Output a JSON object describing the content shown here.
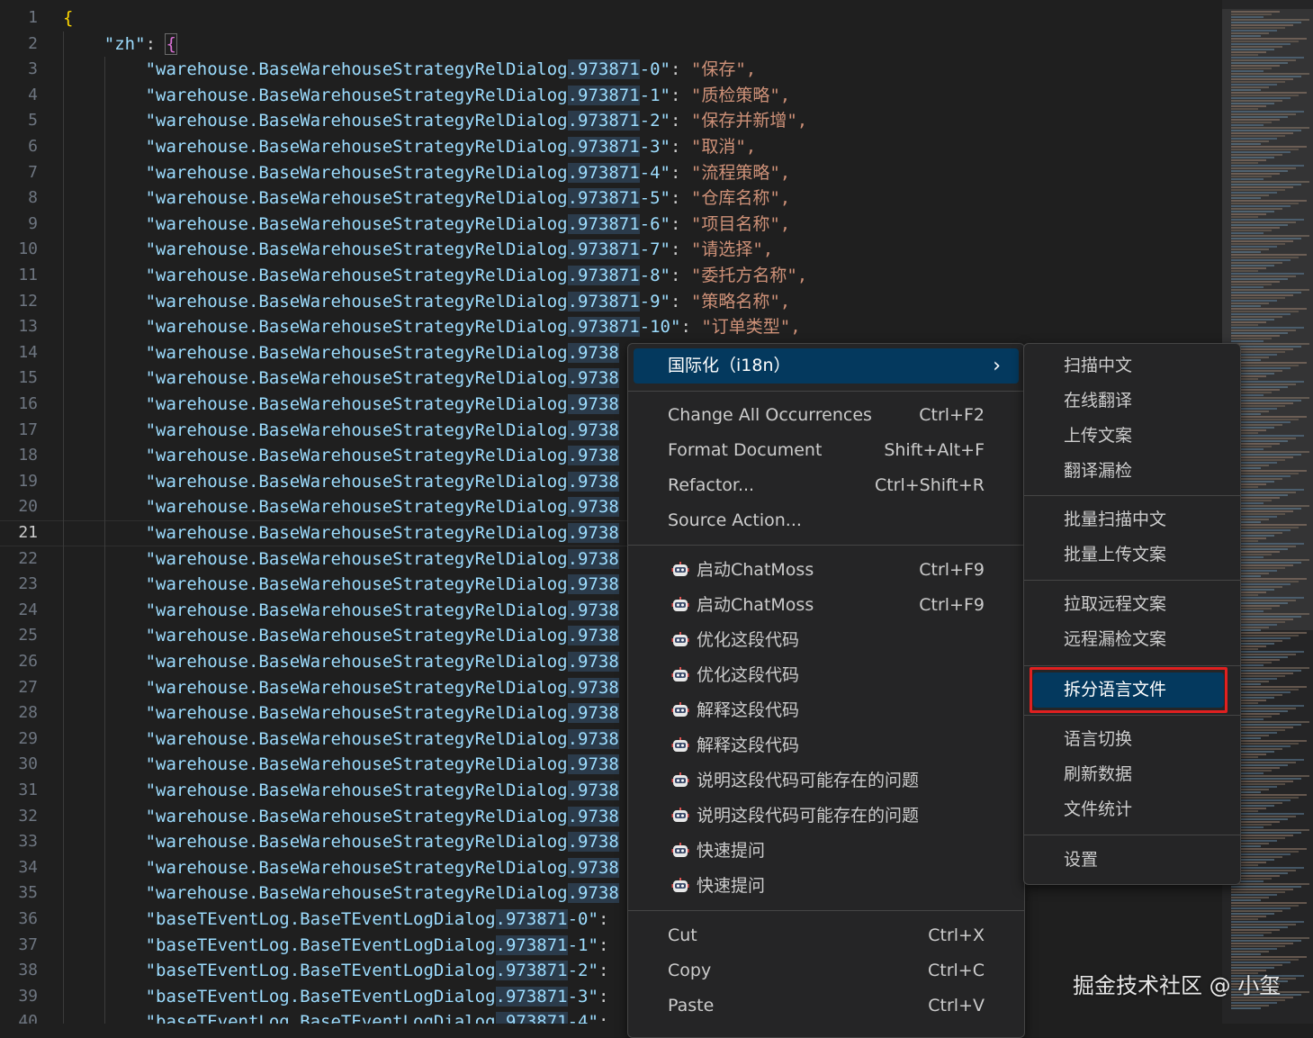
{
  "editor": {
    "current_line": 21,
    "lines": [
      {
        "n": "1",
        "open": "{"
      },
      {
        "n": "2",
        "key": "\"zh\"",
        "brace": "{"
      },
      {
        "n": "3",
        "key": "\"warehouse.BaseWarehouseStrategyRelDialog",
        "hl": ".973871",
        "rest": "-0\"",
        "value": "\"保存\","
      },
      {
        "n": "4",
        "key": "\"warehouse.BaseWarehouseStrategyRelDialog",
        "hl": ".973871",
        "rest": "-1\"",
        "value": "\"质检策略\","
      },
      {
        "n": "5",
        "key": "\"warehouse.BaseWarehouseStrategyRelDialog",
        "hl": ".973871",
        "rest": "-2\"",
        "value": "\"保存并新增\","
      },
      {
        "n": "6",
        "key": "\"warehouse.BaseWarehouseStrategyRelDialog",
        "hl": ".973871",
        "rest": "-3\"",
        "value": "\"取消\","
      },
      {
        "n": "7",
        "key": "\"warehouse.BaseWarehouseStrategyRelDialog",
        "hl": ".973871",
        "rest": "-4\"",
        "value": "\"流程策略\","
      },
      {
        "n": "8",
        "key": "\"warehouse.BaseWarehouseStrategyRelDialog",
        "hl": ".973871",
        "rest": "-5\"",
        "value": "\"仓库名称\","
      },
      {
        "n": "9",
        "key": "\"warehouse.BaseWarehouseStrategyRelDialog",
        "hl": ".973871",
        "rest": "-6\"",
        "value": "\"项目名称\","
      },
      {
        "n": "10",
        "key": "\"warehouse.BaseWarehouseStrategyRelDialog",
        "hl": ".973871",
        "rest": "-7\"",
        "value": "\"请选择\","
      },
      {
        "n": "11",
        "key": "\"warehouse.BaseWarehouseStrategyRelDialog",
        "hl": ".973871",
        "rest": "-8\"",
        "value": "\"委托方名称\","
      },
      {
        "n": "12",
        "key": "\"warehouse.BaseWarehouseStrategyRelDialog",
        "hl": ".973871",
        "rest": "-9\"",
        "value": "\"策略名称\","
      },
      {
        "n": "13",
        "key": "\"warehouse.BaseWarehouseStrategyRelDialog",
        "hl": ".973871",
        "rest": "-10\"",
        "value": "\"订单类型\","
      },
      {
        "n": "14",
        "key": "\"warehouse.BaseWarehouseStrategyRelDialog",
        "hl": ".9738"
      },
      {
        "n": "15",
        "key": "\"warehouse.BaseWarehouseStrategyRelDialog",
        "hl": ".9738"
      },
      {
        "n": "16",
        "key": "\"warehouse.BaseWarehouseStrategyRelDialog",
        "hl": ".9738"
      },
      {
        "n": "17",
        "key": "\"warehouse.BaseWarehouseStrategyRelDialog",
        "hl": ".9738"
      },
      {
        "n": "18",
        "key": "\"warehouse.BaseWarehouseStrategyRelDialog",
        "hl": ".9738"
      },
      {
        "n": "19",
        "key": "\"warehouse.BaseWarehouseStrategyRelDialog",
        "hl": ".9738"
      },
      {
        "n": "20",
        "key": "\"warehouse.BaseWarehouseStrategyRelDialog",
        "hl": ".9738"
      },
      {
        "n": "21",
        "key": "\"warehouse.BaseWarehouseStrategyRelDialog",
        "hl": ".9738"
      },
      {
        "n": "22",
        "key": "\"warehouse.BaseWarehouseStrategyRelDialog",
        "hl": ".9738"
      },
      {
        "n": "23",
        "key": "\"warehouse.BaseWarehouseStrategyRelDialog",
        "hl": ".9738"
      },
      {
        "n": "24",
        "key": "\"warehouse.BaseWarehouseStrategyRelDialog",
        "hl": ".9738"
      },
      {
        "n": "25",
        "key": "\"warehouse.BaseWarehouseStrategyRelDialog",
        "hl": ".9738"
      },
      {
        "n": "26",
        "key": "\"warehouse.BaseWarehouseStrategyRelDialog",
        "hl": ".9738"
      },
      {
        "n": "27",
        "key": "\"warehouse.BaseWarehouseStrategyRelDialog",
        "hl": ".9738"
      },
      {
        "n": "28",
        "key": "\"warehouse.BaseWarehouseStrategyRelDialog",
        "hl": ".9738"
      },
      {
        "n": "29",
        "key": "\"warehouse.BaseWarehouseStrategyRelDialog",
        "hl": ".9738"
      },
      {
        "n": "30",
        "key": "\"warehouse.BaseWarehouseStrategyRelDialog",
        "hl": ".9738"
      },
      {
        "n": "31",
        "key": "\"warehouse.BaseWarehouseStrategyRelDialog",
        "hl": ".9738"
      },
      {
        "n": "32",
        "key": "\"warehouse.BaseWarehouseStrategyRelDialog",
        "hl": ".9738"
      },
      {
        "n": "33",
        "key": "\"warehouse.BaseWarehouseStrategyRelDialog",
        "hl": ".9738"
      },
      {
        "n": "34",
        "key": "\"warehouse.BaseWarehouseStrategyRelDialog",
        "hl": ".9738"
      },
      {
        "n": "35",
        "key": "\"warehouse.BaseWarehouseStrategyRelDialog",
        "hl": ".9738"
      },
      {
        "n": "36",
        "key": "\"baseTEventLog.BaseTEventLogDialog",
        "hl": ".973871",
        "rest": "-0\""
      },
      {
        "n": "37",
        "key": "\"baseTEventLog.BaseTEventLogDialog",
        "hl": ".973871",
        "rest": "-1\""
      },
      {
        "n": "38",
        "key": "\"baseTEventLog.BaseTEventLogDialog",
        "hl": ".973871",
        "rest": "-2\""
      },
      {
        "n": "39",
        "key": "\"baseTEventLog.BaseTEventLogDialog",
        "hl": ".973871",
        "rest": "-3\""
      },
      {
        "n": "40",
        "key": "\"baseTEventLog.BaseTEventLogDialog",
        "hl": ".973871",
        "rest": "-4\""
      }
    ]
  },
  "context_menu": {
    "i18n": {
      "label": "国际化（i18n）",
      "arrow": "›"
    },
    "group1": [
      {
        "label": "Change All Occurrences",
        "shortcut": "Ctrl+F2"
      },
      {
        "label": "Format Document",
        "shortcut": "Shift+Alt+F"
      },
      {
        "label": "Refactor...",
        "shortcut": "Ctrl+Shift+R"
      },
      {
        "label": "Source Action...",
        "shortcut": ""
      }
    ],
    "group2": [
      {
        "label": "启动ChatMoss",
        "shortcut": "Ctrl+F9",
        "icon": "robot-icon"
      },
      {
        "label": "启动ChatMoss",
        "shortcut": "Ctrl+F9",
        "icon": "robot-icon"
      },
      {
        "label": "优化这段代码",
        "shortcut": "",
        "icon": "robot-icon"
      },
      {
        "label": "优化这段代码",
        "shortcut": "",
        "icon": "robot-icon"
      },
      {
        "label": "解释这段代码",
        "shortcut": "",
        "icon": "robot-icon"
      },
      {
        "label": "解释这段代码",
        "shortcut": "",
        "icon": "robot-icon"
      },
      {
        "label": "说明这段代码可能存在的问题",
        "shortcut": "",
        "icon": "robot-icon"
      },
      {
        "label": "说明这段代码可能存在的问题",
        "shortcut": "",
        "icon": "robot-icon"
      },
      {
        "label": "快速提问",
        "shortcut": "",
        "icon": "robot-icon"
      },
      {
        "label": "快速提问",
        "shortcut": "",
        "icon": "robot-icon"
      }
    ],
    "group3": [
      {
        "label": "Cut",
        "shortcut": "Ctrl+X"
      },
      {
        "label": "Copy",
        "shortcut": "Ctrl+C"
      },
      {
        "label": "Paste",
        "shortcut": "Ctrl+V"
      }
    ]
  },
  "submenu": {
    "groups": [
      [
        "扫描中文",
        "在线翻译",
        "上传文案",
        "翻译漏检"
      ],
      [
        "批量扫描中文",
        "批量上传文案"
      ],
      [
        "拉取远程文案",
        "远程漏检文案"
      ],
      [
        "拆分语言文件"
      ],
      [
        "语言切换",
        "刷新数据",
        "文件统计"
      ],
      [
        "设置"
      ]
    ],
    "highlighted": "拆分语言文件"
  },
  "watermark": "掘金技术社区 @ 小玺",
  "colors": {
    "background": "#1f1f1f",
    "key": "#9cdcfe",
    "string": "#ce9178",
    "brace": "#ffd700",
    "menu_bg": "#252526",
    "menu_active": "#04395e",
    "highlight_border": "#e02020"
  }
}
